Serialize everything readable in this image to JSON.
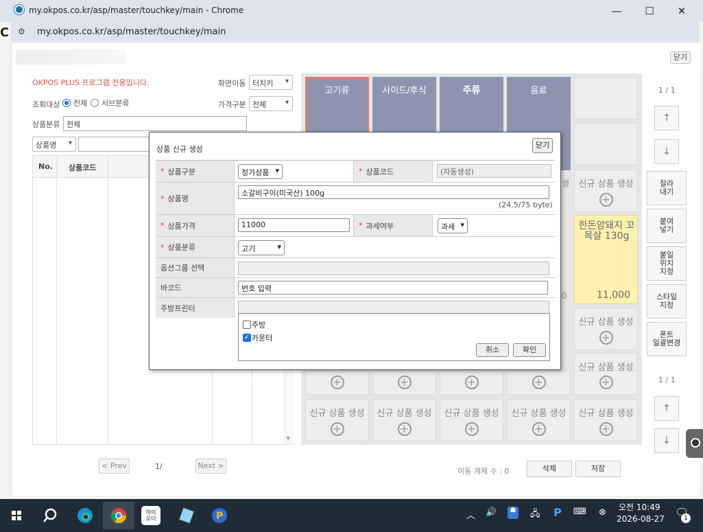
{
  "browser": {
    "title": "my.okpos.co.kr/asp/master/touchkey/main - Chrome",
    "url": "my.okpos.co.kr/asp/master/touchkey/main",
    "controls": {
      "minimize": "—",
      "maximize": "☐",
      "close": "✕"
    }
  },
  "page": {
    "close_label": "닫기",
    "notice": "OKPOS PLUS 프로그램 전용입니다.",
    "screen_move_label": "화면이동",
    "screen_move_value": "터치키",
    "query_target_label": "조회대상",
    "radio_all": "전체",
    "radio_sub": "서브분류",
    "price_type_label": "가격구분",
    "price_type_value": "전체",
    "product_category_label": "상품분류",
    "product_category_value": "전체",
    "search_field_value": "상품명",
    "table_headers": [
      "No.",
      "상품코드"
    ],
    "prev_label": "< Prev",
    "page_indicator": "1/",
    "next_label": "Next >"
  },
  "touchkey": {
    "tabs": [
      "고기류",
      "사이드/후식",
      "주류",
      "음료"
    ],
    "new_label": "신규 상품 생성",
    "featured": {
      "name": "한돈암돼지 꼬목살 130g",
      "price": "11,000"
    },
    "page_top": "1 / 1",
    "page_bottom": "1 / 1",
    "side_buttons": [
      "잘라\n내기",
      "붙여\n넣기",
      "붙일\n위치\n지정",
      "스타일\n지정",
      "폰트\n일괄변경"
    ],
    "move_count": "이동 개체 수 : 0",
    "delete_label": "삭제",
    "save_label": "저장",
    "frag_left_0": "생",
    "frag_left_1": "0"
  },
  "dialog": {
    "title": "상품 신규 생성",
    "close_label": "닫기",
    "type_label": "상품구분",
    "type_value": "정가상품",
    "code_label": "상품코드",
    "code_value": "(자동생성)",
    "name_label": "상품명",
    "name_value": "소갈비구이(미국산) 100g",
    "byte_count": "(24.5/75 byte)",
    "price_label": "상품가격",
    "price_value": "11000",
    "tax_label": "과세여부",
    "tax_value": "과세",
    "category_label": "상품분류",
    "category_value": "고기",
    "option_label": "옵션그룹 선택",
    "barcode_label": "바코드",
    "barcode_placeholder": "번호 입력",
    "printer_label": "주방프린터",
    "printer_options": [
      {
        "label": "주방",
        "checked": false
      },
      {
        "label": "카운터",
        "checked": true
      }
    ],
    "cancel_label": "취소",
    "confirm_label": "확인"
  },
  "taskbar": {
    "time": "오전 10:49",
    "date": "2026-08-27",
    "app_label": "하이\n오더",
    "notification_count": "1"
  },
  "colors": {
    "tab": "#8e94b0",
    "active_tab_border": "#e07b7b",
    "featured_bg": "#fff2b0",
    "notice": "#e0534a",
    "accent": "#1a73e8"
  }
}
